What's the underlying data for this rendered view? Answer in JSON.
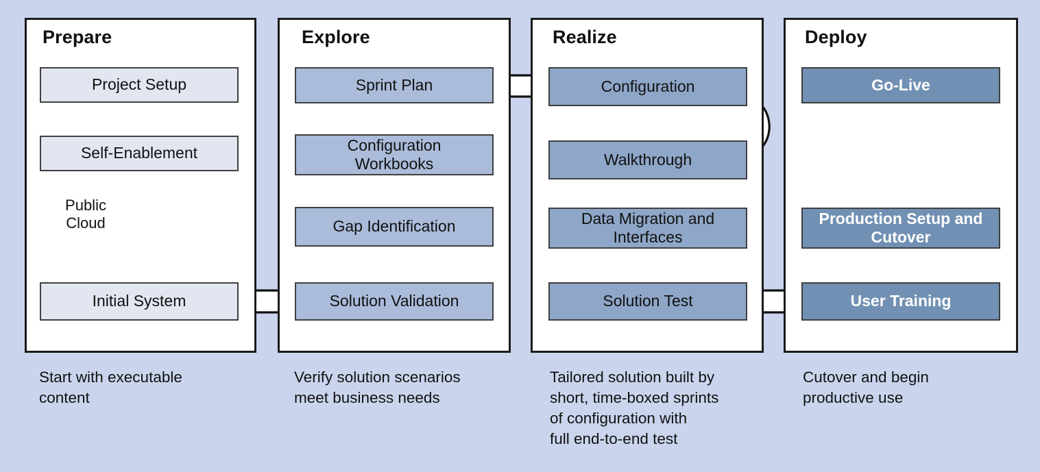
{
  "diagram": {
    "title": "SAP Activate phased implementation methodology",
    "background_color": "#cad5ed",
    "phases": [
      {
        "id": "prepare",
        "title": "Prepare",
        "node_style": "lvl1",
        "node_color": "#e1e6f0",
        "nodes": [
          {
            "id": "project-setup",
            "label": "Project Setup"
          },
          {
            "id": "self-enablement",
            "label": "Self-Enablement"
          },
          {
            "id": "initial-system",
            "label": "Initial System"
          }
        ],
        "cloud": {
          "id": "public-cloud",
          "label": "Public\nCloud"
        },
        "caption": "Start with executable\ncontent"
      },
      {
        "id": "explore",
        "title": "Explore",
        "node_style": "lvl2",
        "node_color": "#aabcda",
        "nodes": [
          {
            "id": "sprint-plan",
            "label": "Sprint Plan"
          },
          {
            "id": "configuration-workbooks",
            "label": "Configuration\nWorkbooks"
          },
          {
            "id": "gap-identification",
            "label": "Gap Identification"
          },
          {
            "id": "solution-validation",
            "label": "Solution Validation"
          }
        ],
        "caption": "Verify solution scenarios\nmeet business needs"
      },
      {
        "id": "realize",
        "title": "Realize",
        "node_style": "lvl3",
        "node_color": "#8ea6c7",
        "nodes": [
          {
            "id": "configuration",
            "label": "Configuration"
          },
          {
            "id": "walkthrough",
            "label": "Walkthrough"
          },
          {
            "id": "data-migration-and-interfaces",
            "label": "Data Migration and\nInterfaces"
          },
          {
            "id": "solution-test",
            "label": "Solution Test"
          }
        ],
        "caption": "Tailored solution built by\nshort, time-boxed sprints\nof configuration with\nfull end-to-end test"
      },
      {
        "id": "deploy",
        "title": "Deploy",
        "node_style": "lvl4",
        "node_color": "#7190b3",
        "nodes": [
          {
            "id": "go-live",
            "label": "Go-Live"
          },
          {
            "id": "production-setup-and-cutover",
            "label": "Production Setup and\nCutover"
          },
          {
            "id": "user-training",
            "label": "User Training"
          }
        ],
        "caption": "Cutover and begin\nproductive use"
      }
    ],
    "connectors": [
      {
        "id": "project-setup-to-self-enablement",
        "from": "project-setup",
        "to": "self-enablement",
        "direction": "down"
      },
      {
        "id": "self-enablement-to-initial-system",
        "from": "self-enablement",
        "to": "initial-system",
        "direction": "down"
      },
      {
        "id": "initial-system-to-solution-validation",
        "from": "initial-system",
        "to": "solution-validation",
        "direction": "right"
      },
      {
        "id": "solution-validation-to-gap-identification",
        "from": "solution-validation",
        "to": "gap-identification",
        "direction": "up"
      },
      {
        "id": "gap-identification-to-configuration-workbooks",
        "from": "gap-identification",
        "to": "configuration-workbooks",
        "direction": "up"
      },
      {
        "id": "configuration-workbooks-to-sprint-plan",
        "from": "configuration-workbooks",
        "to": "sprint-plan",
        "direction": "up"
      },
      {
        "id": "sprint-plan-to-configuration",
        "from": "sprint-plan",
        "to": "configuration",
        "direction": "right"
      },
      {
        "id": "configuration-to-walkthrough",
        "from": "configuration",
        "to": "walkthrough",
        "direction": "down"
      },
      {
        "id": "walkthrough-to-data-migration",
        "from": "walkthrough",
        "to": "data-migration-and-interfaces",
        "direction": "down"
      },
      {
        "id": "data-migration-to-solution-test",
        "from": "data-migration-and-interfaces",
        "to": "solution-test",
        "direction": "down"
      },
      {
        "id": "configuration-walkthrough-iteration-loop",
        "from": "configuration",
        "to": "walkthrough",
        "direction": "cycle"
      },
      {
        "id": "solution-test-to-user-training",
        "from": "solution-test",
        "to": "user-training",
        "direction": "right"
      },
      {
        "id": "user-training-to-production-setup",
        "from": "user-training",
        "to": "production-setup-and-cutover",
        "direction": "up"
      },
      {
        "id": "production-setup-to-go-live",
        "from": "production-setup-and-cutover",
        "to": "go-live",
        "direction": "up"
      }
    ]
  }
}
